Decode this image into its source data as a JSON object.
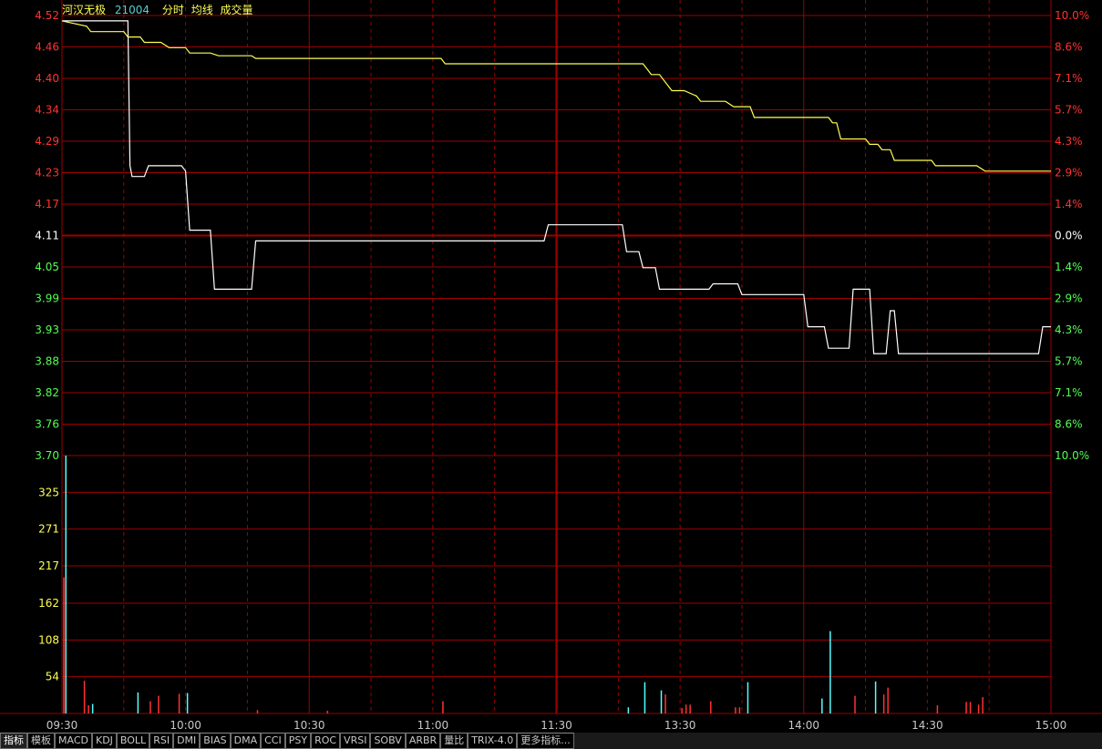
{
  "header": {
    "stock_name": "河汉无极",
    "stock_code": "21004",
    "label_mode": "分时",
    "label_avg": "均线",
    "label_volume": "成交量"
  },
  "tabs": [
    "指标",
    "模板",
    "MACD",
    "KDJ",
    "BOLL",
    "RSI",
    "DMI",
    "BIAS",
    "DMA",
    "CCI",
    "PSY",
    "ROC",
    "VRSI",
    "SOBV",
    "ARBR",
    "量比",
    "TRIX-4.0",
    "更多指标..."
  ],
  "colors": {
    "grid": "#a00000",
    "up": "#ff3232",
    "down": "#54ff54",
    "neutral": "#ffffff",
    "price_line": "#ffffff",
    "avg_line": "#ffff54",
    "vol_up": "#ff3232",
    "vol_down": "#54ffff",
    "time_label": "#c8c8c8",
    "vol_label": "#ffff54"
  },
  "chart_data": {
    "type": "line",
    "prev_close": 4.11,
    "price_axis": {
      "ticks": [
        "4.52",
        "4.46",
        "4.40",
        "4.34",
        "4.29",
        "4.23",
        "4.17",
        "4.11",
        "4.05",
        "3.99",
        "3.93",
        "3.88",
        "3.82",
        "3.76",
        "3.70"
      ],
      "pct_ticks": [
        "10.0%",
        "8.6%",
        "7.1%",
        "5.7%",
        "4.3%",
        "2.9%",
        "1.4%",
        "0.0%",
        "1.4%",
        "2.9%",
        "4.3%",
        "5.7%",
        "7.1%",
        "8.6%",
        "10.0%"
      ],
      "range": [
        3.7,
        4.52
      ]
    },
    "volume_axis": {
      "ticks": [
        "325",
        "271",
        "217",
        "162",
        "108",
        "54"
      ],
      "range": [
        0,
        379
      ]
    },
    "time_axis": {
      "labels": [
        "09:30",
        "10:00",
        "10:30",
        "11:00",
        "11:30",
        "13:30",
        "14:00",
        "14:30",
        "15:00"
      ],
      "total_minutes": 240
    },
    "series": [
      {
        "name": "分时",
        "points": [
          [
            0,
            4.51
          ],
          [
            16,
            4.51
          ],
          [
            16.5,
            4.24
          ],
          [
            17,
            4.22
          ],
          [
            20,
            4.22
          ],
          [
            21,
            4.24
          ],
          [
            29,
            4.24
          ],
          [
            30,
            4.23
          ],
          [
            31,
            4.12
          ],
          [
            36,
            4.12
          ],
          [
            37,
            4.01
          ],
          [
            46,
            4.01
          ],
          [
            47,
            4.1
          ],
          [
            117,
            4.1
          ],
          [
            118,
            4.13
          ],
          [
            136,
            4.13
          ],
          [
            137,
            4.08
          ],
          [
            140,
            4.08
          ],
          [
            141,
            4.05
          ],
          [
            144,
            4.05
          ],
          [
            145,
            4.01
          ],
          [
            157,
            4.01
          ],
          [
            158,
            4.02
          ],
          [
            164,
            4.02
          ],
          [
            165,
            4.0
          ],
          [
            180,
            4.0
          ],
          [
            181,
            3.94
          ],
          [
            185,
            3.94
          ],
          [
            186,
            3.9
          ],
          [
            191,
            3.9
          ],
          [
            192,
            4.01
          ],
          [
            196,
            4.01
          ],
          [
            197,
            3.89
          ],
          [
            200,
            3.89
          ],
          [
            201,
            3.97
          ],
          [
            202,
            3.97
          ],
          [
            203,
            3.89
          ],
          [
            237,
            3.89
          ],
          [
            238,
            3.94
          ],
          [
            240,
            3.94
          ]
        ]
      },
      {
        "name": "均线",
        "points": [
          [
            0,
            4.51
          ],
          [
            6,
            4.5
          ],
          [
            7,
            4.49
          ],
          [
            15,
            4.49
          ],
          [
            16,
            4.48
          ],
          [
            19,
            4.48
          ],
          [
            20,
            4.47
          ],
          [
            24,
            4.47
          ],
          [
            26,
            4.46
          ],
          [
            30,
            4.46
          ],
          [
            31,
            4.45
          ],
          [
            36,
            4.45
          ],
          [
            38,
            4.445
          ],
          [
            46,
            4.445
          ],
          [
            47,
            4.44
          ],
          [
            92,
            4.44
          ],
          [
            93,
            4.43
          ],
          [
            141,
            4.43
          ],
          [
            142,
            4.42
          ],
          [
            143,
            4.41
          ],
          [
            145,
            4.41
          ],
          [
            148,
            4.38
          ],
          [
            151,
            4.38
          ],
          [
            154,
            4.37
          ],
          [
            155,
            4.36
          ],
          [
            161,
            4.36
          ],
          [
            163,
            4.35
          ],
          [
            167,
            4.35
          ],
          [
            168,
            4.33
          ],
          [
            186,
            4.33
          ],
          [
            187,
            4.32
          ],
          [
            188,
            4.32
          ],
          [
            189,
            4.29
          ],
          [
            195,
            4.29
          ],
          [
            196,
            4.28
          ],
          [
            198,
            4.28
          ],
          [
            199,
            4.27
          ],
          [
            201,
            4.27
          ],
          [
            202,
            4.25
          ],
          [
            211,
            4.25
          ],
          [
            212,
            4.24
          ],
          [
            222,
            4.24
          ],
          [
            224,
            4.23
          ],
          [
            240,
            4.23
          ]
        ]
      }
    ],
    "volume_bars": [
      [
        0,
        200,
        "up"
      ],
      [
        0.5,
        379,
        "down"
      ],
      [
        5,
        48,
        "up"
      ],
      [
        6,
        12,
        "up"
      ],
      [
        7,
        14,
        "down"
      ],
      [
        18,
        31,
        "down"
      ],
      [
        21,
        18,
        "up"
      ],
      [
        23,
        26,
        "up"
      ],
      [
        28,
        29,
        "up"
      ],
      [
        30,
        30,
        "down"
      ],
      [
        47,
        5,
        "up"
      ],
      [
        64,
        4,
        "up"
      ],
      [
        92,
        18,
        "up"
      ],
      [
        137,
        9,
        "down"
      ],
      [
        141,
        46,
        "down"
      ],
      [
        145,
        34,
        "down"
      ],
      [
        146,
        28,
        "up"
      ],
      [
        150,
        8,
        "up"
      ],
      [
        151,
        13,
        "up"
      ],
      [
        152,
        13,
        "up"
      ],
      [
        157,
        18,
        "up"
      ],
      [
        163,
        9,
        "up"
      ],
      [
        164,
        9,
        "up"
      ],
      [
        166,
        46,
        "down"
      ],
      [
        184,
        22,
        "down"
      ],
      [
        186,
        121,
        "down"
      ],
      [
        192,
        26,
        "up"
      ],
      [
        197,
        47,
        "down"
      ],
      [
        199,
        28,
        "up"
      ],
      [
        200,
        38,
        "up"
      ],
      [
        212,
        12,
        "up"
      ],
      [
        219,
        17,
        "up"
      ],
      [
        220,
        17,
        "up"
      ],
      [
        222,
        13,
        "up"
      ],
      [
        223,
        24,
        "up"
      ]
    ]
  }
}
